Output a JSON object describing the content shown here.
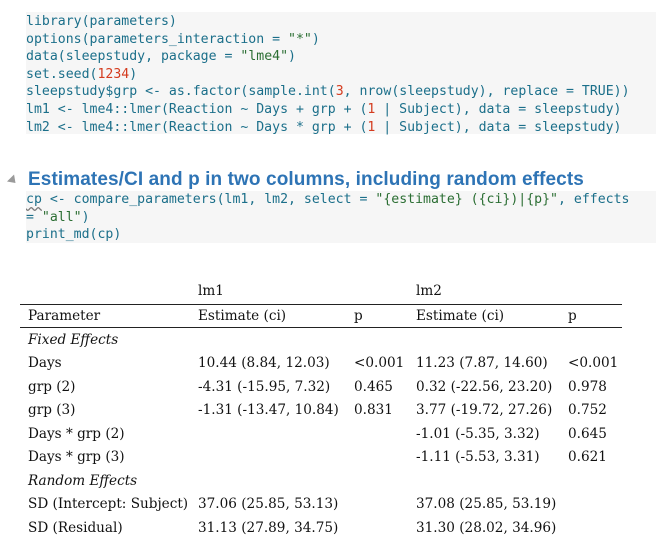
{
  "code_block_1": {
    "lines": [
      [
        {
          "t": "library",
          "c": "fn"
        },
        {
          "t": "(parameters)",
          "c": "op"
        }
      ],
      [
        {
          "t": "options",
          "c": "fn"
        },
        {
          "t": "(parameters_interaction = ",
          "c": "op"
        },
        {
          "t": "\"*\"",
          "c": "str"
        },
        {
          "t": ")",
          "c": "op"
        }
      ],
      [
        {
          "t": "data",
          "c": "fn"
        },
        {
          "t": "(sleepstudy, package = ",
          "c": "op"
        },
        {
          "t": "\"lme4\"",
          "c": "str"
        },
        {
          "t": ")",
          "c": "op"
        }
      ],
      [
        {
          "t": "set.seed",
          "c": "fn"
        },
        {
          "t": "(",
          "c": "op"
        },
        {
          "t": "1234",
          "c": "num"
        },
        {
          "t": ")",
          "c": "op"
        }
      ],
      [
        {
          "t": "sleepstudy$grp <- ",
          "c": "op"
        },
        {
          "t": "as.factor",
          "c": "fn"
        },
        {
          "t": "(",
          "c": "op"
        },
        {
          "t": "sample.int",
          "c": "fn"
        },
        {
          "t": "(",
          "c": "op"
        },
        {
          "t": "3",
          "c": "num"
        },
        {
          "t": ", ",
          "c": "op"
        },
        {
          "t": "nrow",
          "c": "fn"
        },
        {
          "t": "(sleepstudy), replace = ",
          "c": "op"
        },
        {
          "t": "TRUE",
          "c": "kw"
        },
        {
          "t": "))",
          "c": "op"
        }
      ],
      [
        {
          "t": "lm1 <- lme4::lmer(Reaction ~ Days + grp + (",
          "c": "op"
        },
        {
          "t": "1",
          "c": "num"
        },
        {
          "t": " | Subject), data = sleepstudy)",
          "c": "op"
        }
      ],
      [
        {
          "t": "lm2 <- lme4::lmer(Reaction ~ Days * grp + (",
          "c": "op"
        },
        {
          "t": "1",
          "c": "num"
        },
        {
          "t": " | Subject), data = sleepstudy)",
          "c": "op"
        }
      ]
    ]
  },
  "heading": "Estimates/CI and p in two columns, including random effects",
  "code_block_2": {
    "lines": [
      [
        {
          "t": "cp",
          "c": "sq"
        },
        {
          "t": " <- ",
          "c": "op"
        },
        {
          "t": "compare_parameters",
          "c": "fn"
        },
        {
          "t": "(lm1, lm2, select = ",
          "c": "op"
        },
        {
          "t": "\"{estimate} ({ci})|{p}\"",
          "c": "str"
        },
        {
          "t": ", effects",
          "c": "op"
        }
      ],
      [
        {
          "t": "= ",
          "c": "op"
        },
        {
          "t": "\"all\"",
          "c": "str"
        },
        {
          "t": ")",
          "c": "op"
        }
      ],
      [
        {
          "t": "print_md",
          "c": "fn"
        },
        {
          "t": "(cp)",
          "c": "op"
        }
      ]
    ]
  },
  "table": {
    "model_row": [
      "",
      "lm1",
      "",
      "lm2",
      ""
    ],
    "header": [
      "Parameter",
      "Estimate (ci)",
      "p",
      "Estimate (ci)",
      "p"
    ],
    "rows": [
      {
        "type": "section",
        "cells": [
          "Fixed Effects",
          "",
          "",
          "",
          ""
        ]
      },
      {
        "type": "data",
        "cells": [
          "Days",
          "10.44 (8.84, 12.03)",
          "<0.001",
          "11.23 (7.87, 14.60)",
          "<0.001"
        ]
      },
      {
        "type": "data",
        "cells": [
          "grp (2)",
          "-4.31 (-15.95, 7.32)",
          "0.465",
          "0.32 (-22.56, 23.20)",
          "0.978"
        ]
      },
      {
        "type": "data",
        "cells": [
          "grp (3)",
          "-1.31 (-13.47, 10.84)",
          "0.831",
          "3.77 (-19.72, 27.26)",
          "0.752"
        ]
      },
      {
        "type": "data",
        "cells": [
          "Days * grp (2)",
          "",
          "",
          "-1.01 (-5.35, 3.32)",
          "0.645"
        ]
      },
      {
        "type": "data",
        "cells": [
          "Days * grp (3)",
          "",
          "",
          "-1.11 (-5.53, 3.31)",
          "0.621"
        ]
      },
      {
        "type": "section",
        "cells": [
          "Random Effects",
          "",
          "",
          "",
          ""
        ]
      },
      {
        "type": "data",
        "cells": [
          "SD (Intercept: Subject)",
          "37.06 (25.85, 53.13)",
          "",
          "37.08 (25.85, 53.19)",
          ""
        ]
      },
      {
        "type": "data",
        "cells": [
          "SD (Residual)",
          "31.13 (27.89, 34.75)",
          "",
          "31.30 (28.02, 34.96)",
          ""
        ]
      }
    ]
  },
  "colors": {
    "heading": "#2e74b5",
    "code_default": "#1b6f8a",
    "code_string": "#2b6e33",
    "code_number": "#d43b1e",
    "code_background": "#f6f6f6"
  },
  "icons": {
    "collapse": "triangle-collapse-icon"
  }
}
